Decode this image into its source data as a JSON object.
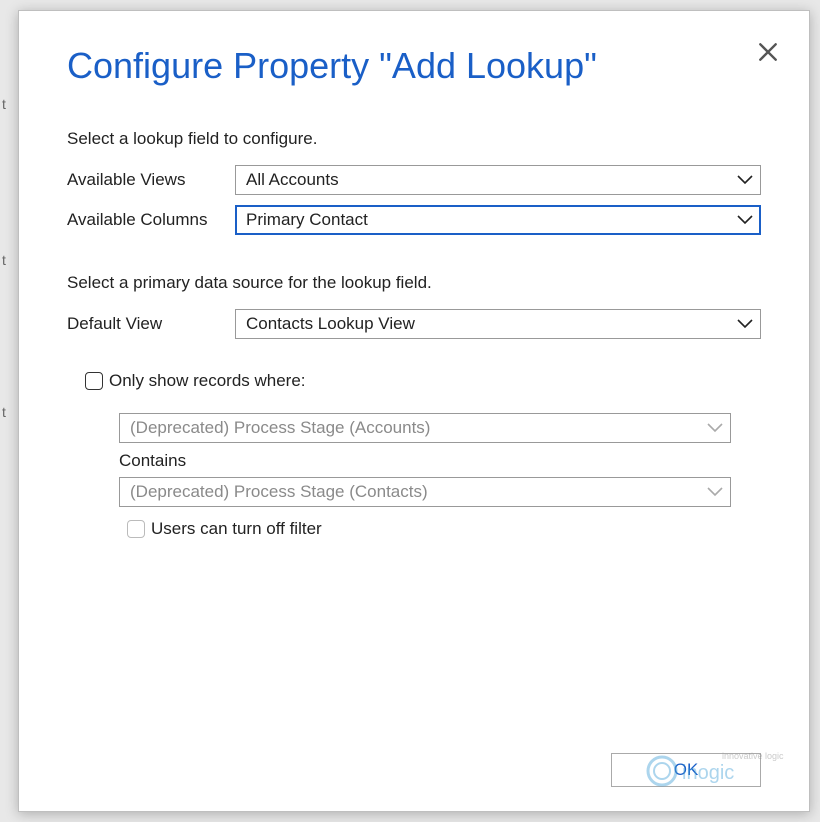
{
  "dialog": {
    "title": "Configure Property \"Add Lookup\"",
    "close_icon": "close-icon"
  },
  "section1": {
    "intro": "Select a lookup field to configure.",
    "available_views_label": "Available Views",
    "available_views_value": "All Accounts",
    "available_columns_label": "Available Columns",
    "available_columns_value": "Primary Contact"
  },
  "section2": {
    "intro": "Select a primary data source for the lookup field.",
    "default_view_label": "Default View",
    "default_view_value": "Contacts Lookup View"
  },
  "filter": {
    "only_show_label": "Only show records where:",
    "only_show_checked": false,
    "field1_value": "(Deprecated) Process Stage (Accounts)",
    "contains_label": "Contains",
    "field2_value": "(Deprecated) Process Stage (Contacts)",
    "users_can_turn_off_label": "Users can turn off filter",
    "users_can_turn_off_checked": false
  },
  "footer": {
    "ok_label": "OK"
  },
  "watermark": {
    "brand": "inogic",
    "tagline": "innovative logic"
  }
}
